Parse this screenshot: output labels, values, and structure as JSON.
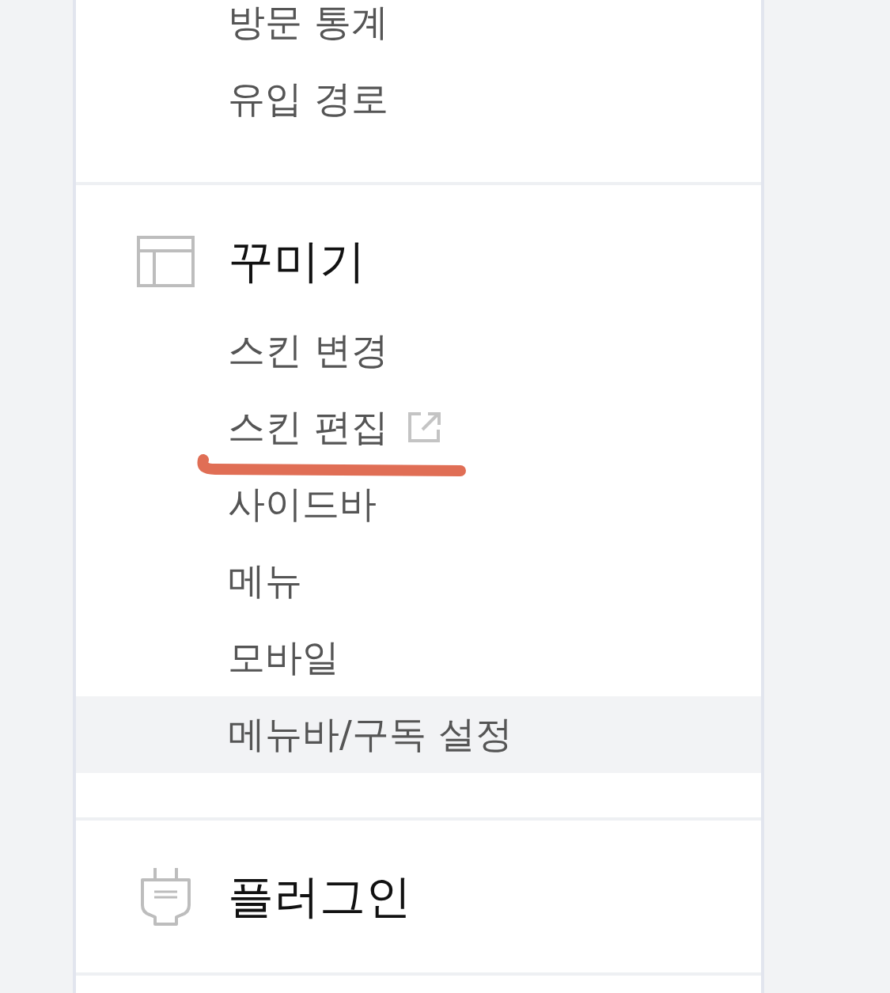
{
  "sidebar": {
    "sections": [
      {
        "items": [
          {
            "label": "방문 통계",
            "selected": false,
            "external": false,
            "marked": false
          },
          {
            "label": "유입 경로",
            "selected": false,
            "external": false,
            "marked": false
          }
        ]
      },
      {
        "title": "꾸미기",
        "items": [
          {
            "label": "스킨 변경",
            "selected": false,
            "external": false,
            "marked": false
          },
          {
            "label": "스킨 편집",
            "selected": false,
            "external": true,
            "marked": true
          },
          {
            "label": "사이드바",
            "selected": false,
            "external": false,
            "marked": false
          },
          {
            "label": "메뉴",
            "selected": false,
            "external": false,
            "marked": false
          },
          {
            "label": "모바일",
            "selected": false,
            "external": false,
            "marked": false
          },
          {
            "label": "메뉴바/구독 설정",
            "selected": true,
            "external": false,
            "marked": false
          }
        ]
      },
      {
        "title": "플러그인"
      }
    ]
  }
}
